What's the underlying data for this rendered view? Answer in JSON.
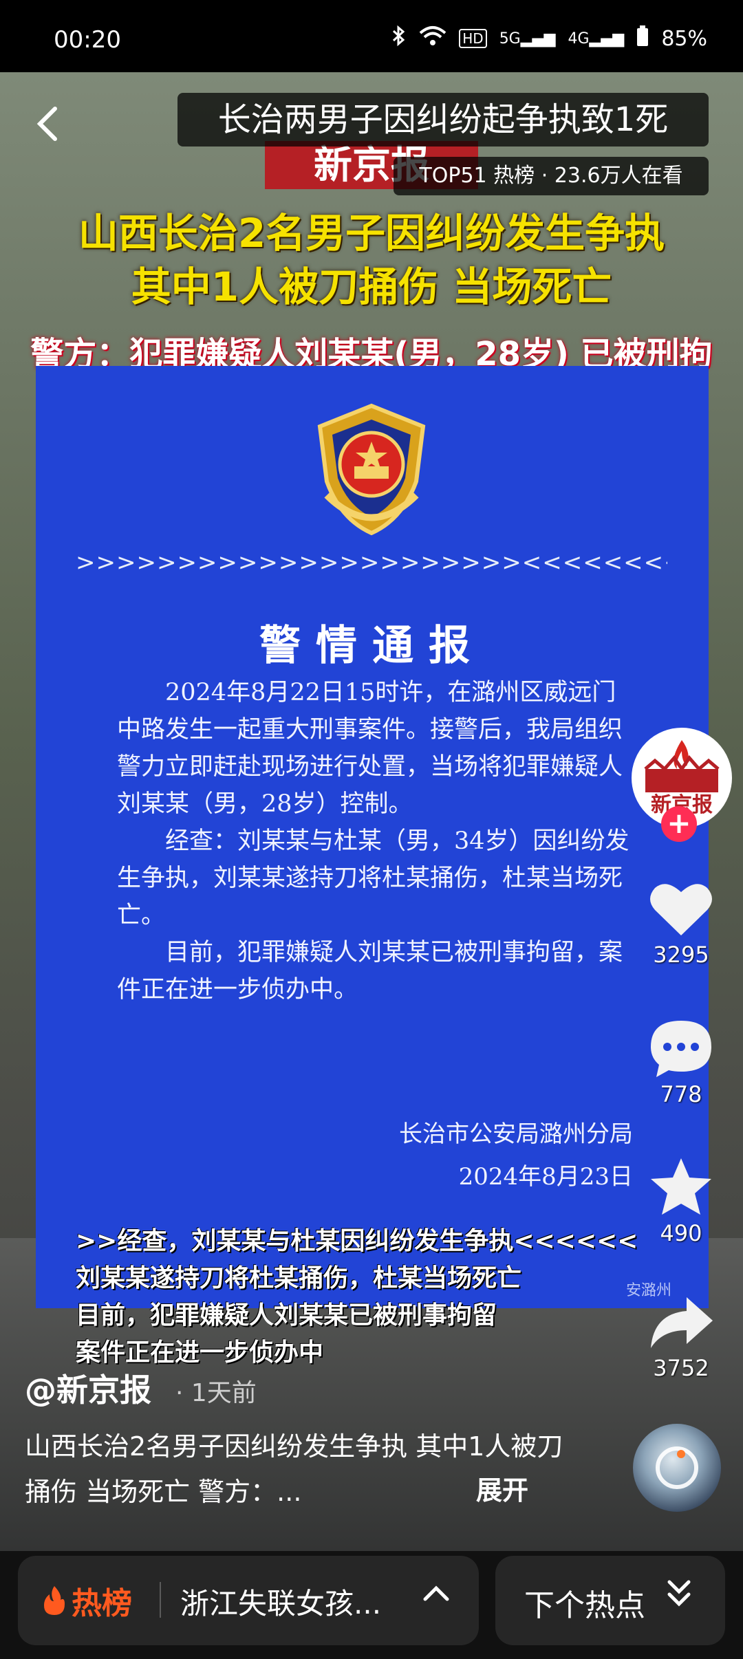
{
  "status_bar": {
    "time": "00:20",
    "battery": "85%",
    "network_1": "5G",
    "network_2": "4G",
    "hd_badge": "HD"
  },
  "video": {
    "title": "长治两男子因纠纷起争执致1死",
    "hot_rank": "TOP51 热榜 · 23.6万人在看",
    "brand": "新京报",
    "headline_line1": "山西长治2名男子因纠纷发生争执",
    "headline_line2": "其中1人被刀捅伤 当场死亡",
    "police_line": "警方：犯罪嫌疑人刘某某(男，28岁) 已被刑拘",
    "notice": {
      "arrows": ">>>>>>>>>>>>>>>>>>>>>><<<<<<<<<<<<<<<<<<<<<<",
      "title": "警情通报",
      "para1": "2024年8月22日15时许，在潞州区威远门中路发生一起重大刑事案件。接警后，我局组织警力立即赶赴现场进行处置，当场将犯罪嫌疑人刘某某（男，28岁）控制。",
      "para2": "经查：刘某某与杜某（男，34岁）因纠纷发生争执，刘某某遂持刀将杜某捅伤，杜某当场死亡。",
      "para3": "目前，犯罪嫌疑人刘某某已被刑事拘留，案件正在进一步侦办中。",
      "sign_org": "长治市公安局潞州分局",
      "sign_date": "2024年8月23日"
    },
    "subtitle_line1": ">>经查，刘某某与杜某因纠纷发生争执<<<<<<",
    "subtitle_line2": "刘某某遂持刀将杜某捅伤，杜某当场死亡",
    "subtitle_line3": "目前，犯罪嫌疑人刘某某已被刑事拘留",
    "subtitle_line4": "案件正在进一步侦办中",
    "watermark": "安潞州"
  },
  "rail": {
    "avatar_text": "新京报",
    "follow": "+",
    "likes": "3295",
    "comments": "778",
    "favorites": "490",
    "shares": "3752"
  },
  "caption": {
    "author": "@新京报",
    "time": "· 1天前",
    "description": "山西长治2名男子因纠纷发生争执 其中1人被刀捅伤 当场死亡 警方：...",
    "expand": "展开"
  },
  "bottom_bar": {
    "hot_label": "热榜",
    "hot_topic": "浙江失联女孩...",
    "next_label": "下个热点"
  },
  "colors": {
    "notice_blue": "#2244d6",
    "headline_yellow": "#f6e200",
    "hot_orange": "#ff5a1f",
    "follow_pink": "#ff2d55"
  }
}
